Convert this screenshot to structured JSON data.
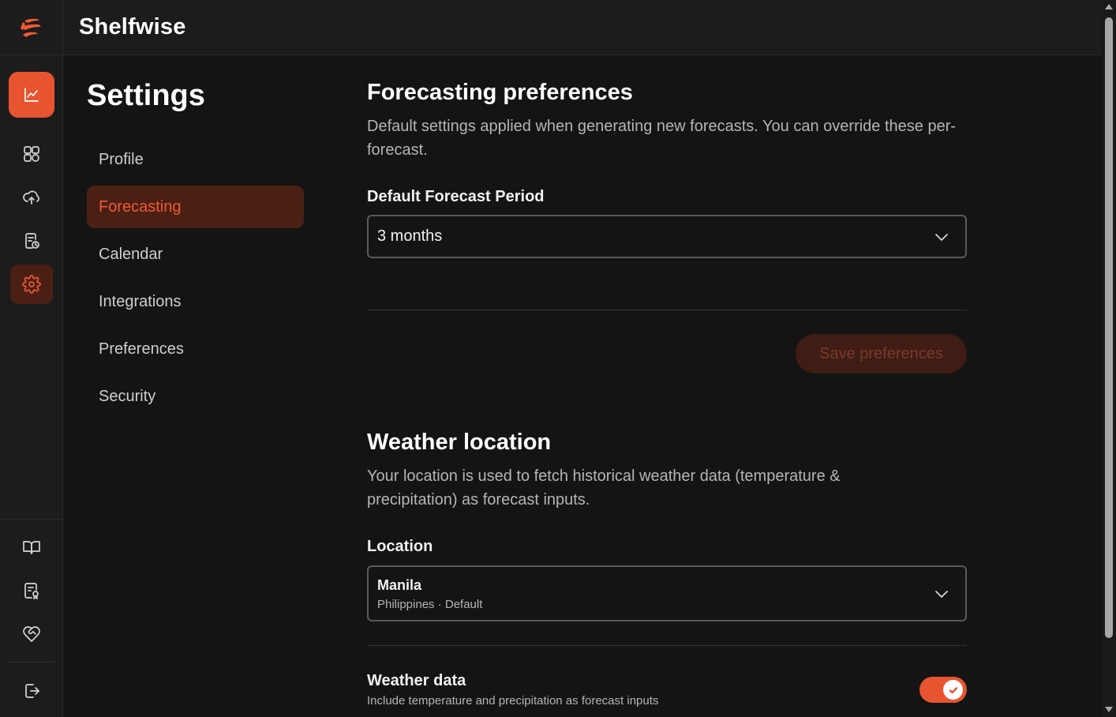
{
  "app": {
    "brand": "Shelfwise",
    "accent_color": "#e8542f"
  },
  "rail": {
    "items": [
      {
        "icon": "chart-line-icon"
      },
      {
        "icon": "dashboard-grid-icon"
      },
      {
        "icon": "cloud-sync-icon"
      },
      {
        "icon": "report-clock-icon"
      },
      {
        "icon": "gear-icon",
        "active": true
      },
      {
        "icon": "book-open-icon"
      },
      {
        "icon": "document-badge-icon"
      },
      {
        "icon": "heart-handshake-icon"
      },
      {
        "icon": "logout-icon"
      }
    ]
  },
  "settings": {
    "title": "Settings",
    "nav": [
      {
        "label": "Profile"
      },
      {
        "label": "Forecasting",
        "active": true
      },
      {
        "label": "Calendar"
      },
      {
        "label": "Integrations"
      },
      {
        "label": "Preferences"
      },
      {
        "label": "Security"
      }
    ]
  },
  "forecasting": {
    "heading": "Forecasting preferences",
    "description": "Default settings applied when generating new forecasts. You can override these per-forecast.",
    "period_label": "Default Forecast Period",
    "period_value": "3 months",
    "save_label": "Save preferences"
  },
  "weather": {
    "heading": "Weather location",
    "description": "Your location is used to fetch historical weather data (temperature & precipitation) as forecast inputs.",
    "location_label": "Location",
    "location_city": "Manila",
    "location_detail": "Philippines · Default",
    "data_title": "Weather data",
    "data_description": "Include temperature and precipitation as forecast inputs",
    "data_enabled": true
  }
}
